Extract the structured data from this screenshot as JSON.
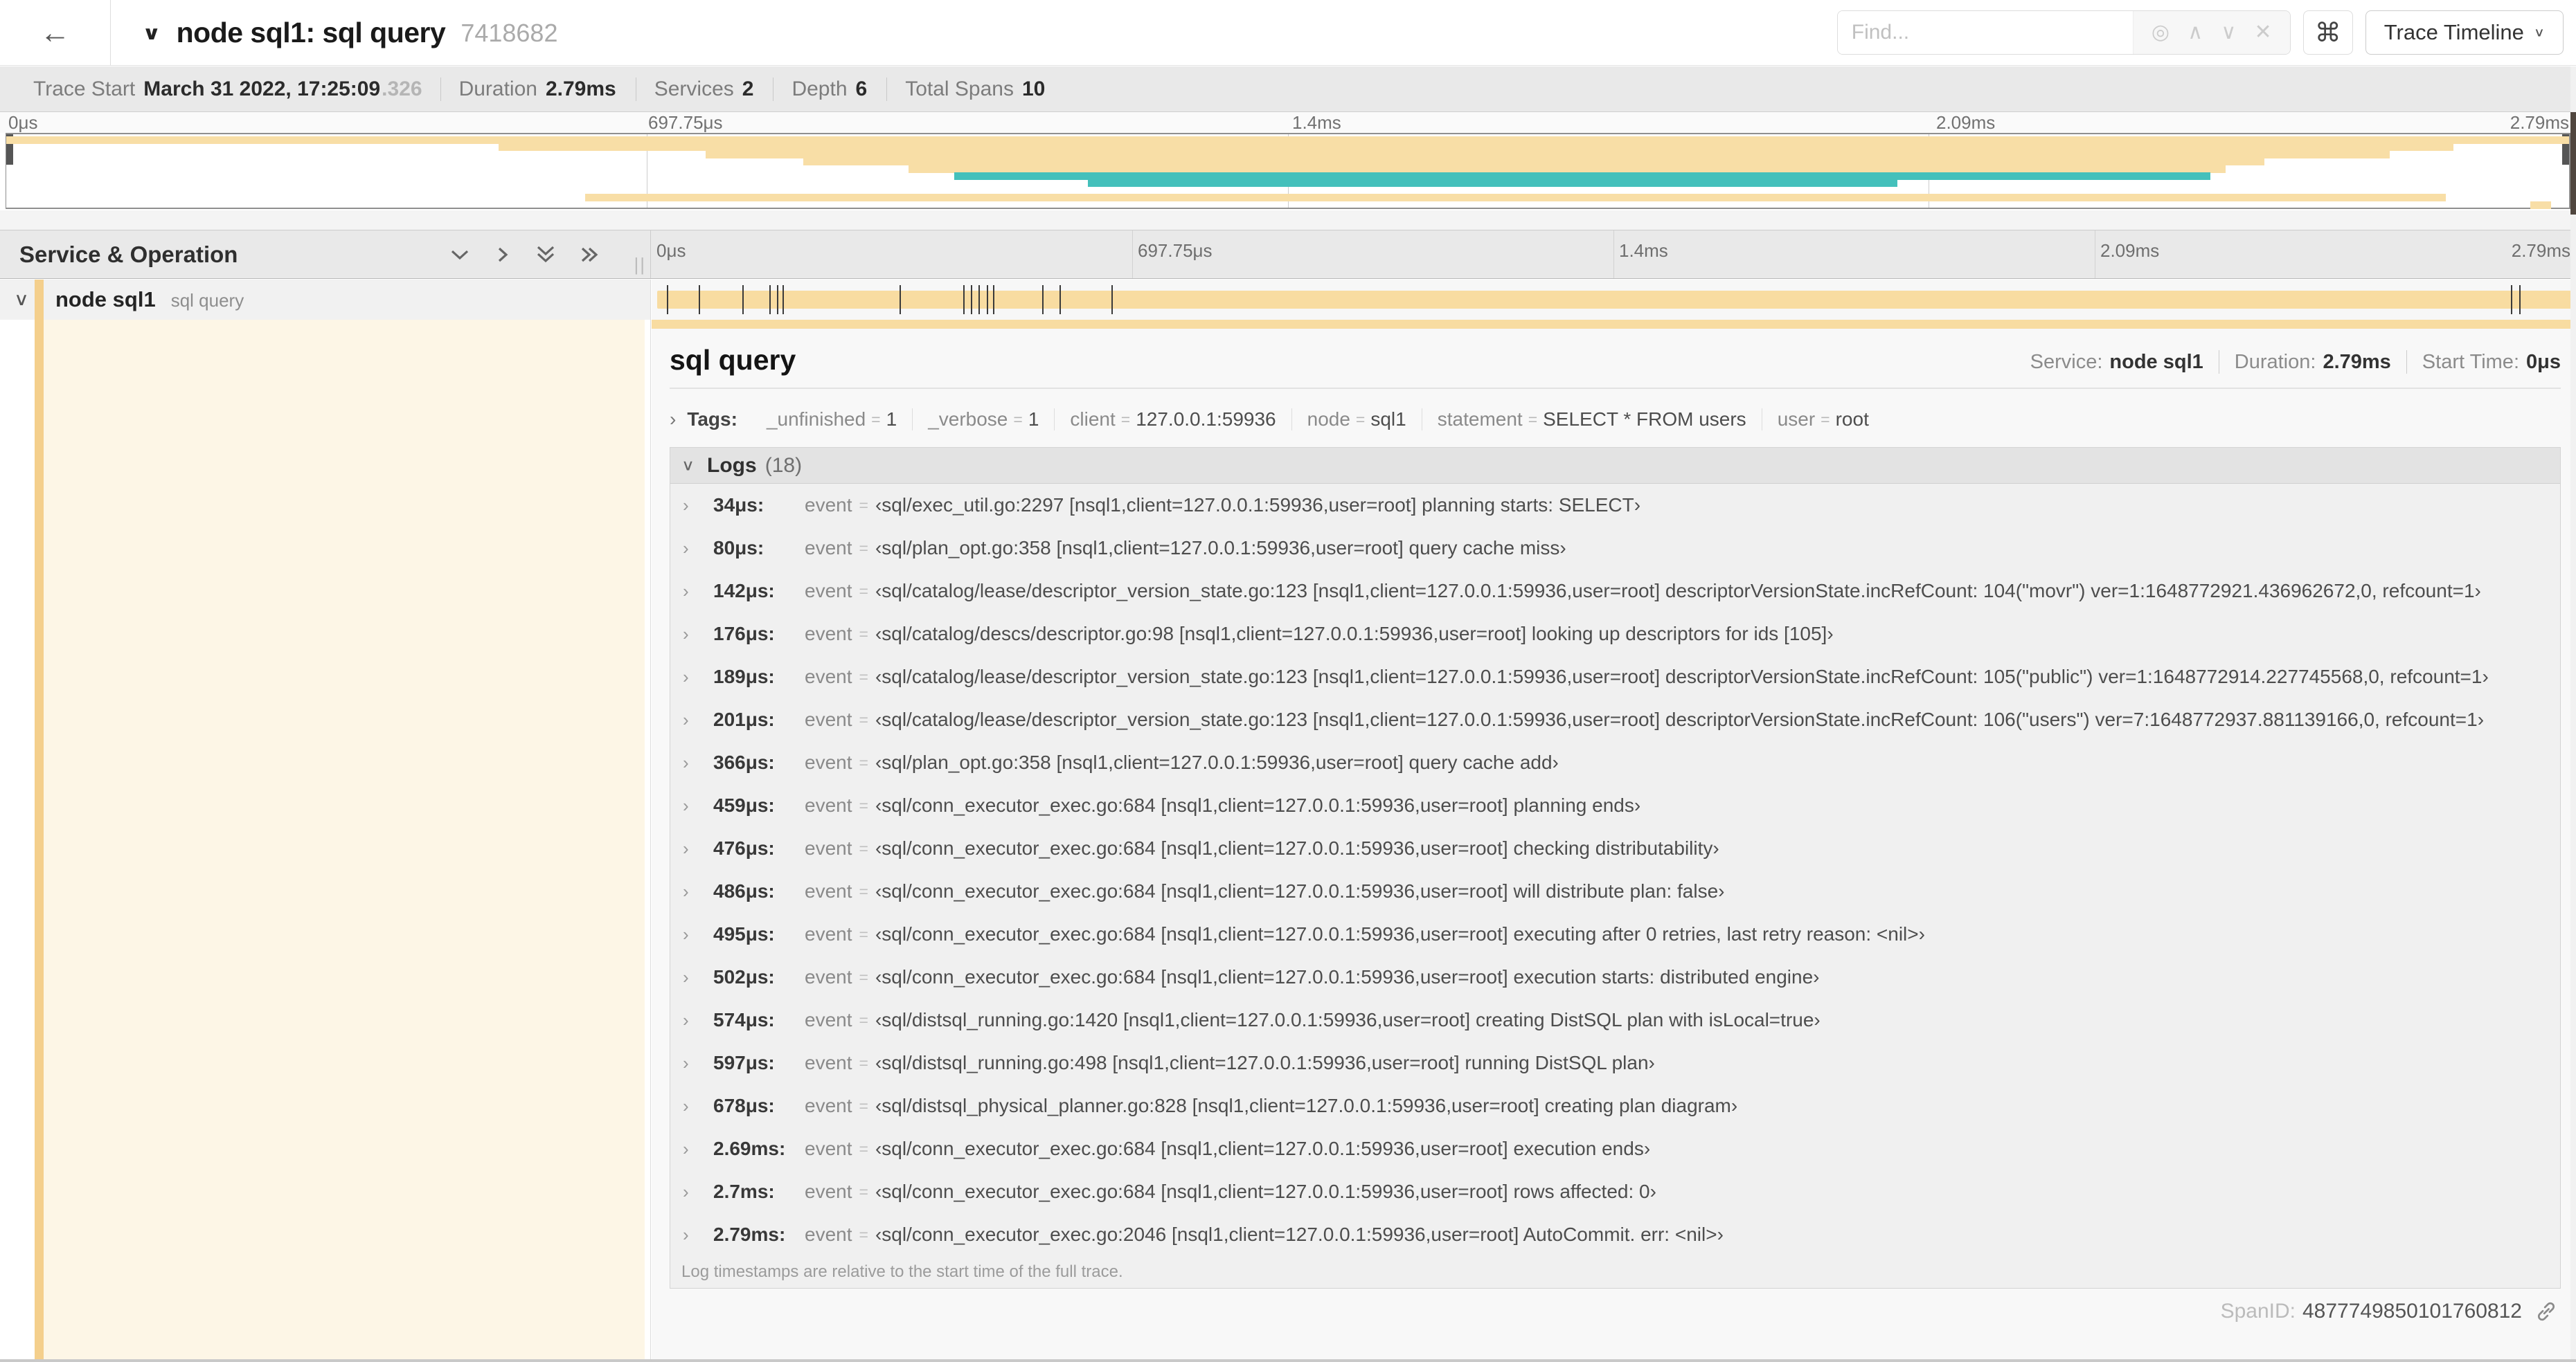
{
  "header": {
    "back_icon": "←",
    "collapse_icon": "∨",
    "title": "node sql1: sql query",
    "trace_id": "7418682",
    "find_placeholder": "Find...",
    "find_icons": {
      "locate": "◎",
      "prev": "∧",
      "next": "∨",
      "clear": "✕"
    },
    "shortcut_icon": "⌘",
    "view_selector": "Trace Timeline",
    "view_selector_chevron": "∨"
  },
  "summary": {
    "items": [
      {
        "label": "Trace Start",
        "value": "March 31 2022, 17:25:09",
        "suffix": ".326"
      },
      {
        "label": "Duration",
        "value": "2.79ms",
        "suffix": ""
      },
      {
        "label": "Services",
        "value": "2",
        "suffix": ""
      },
      {
        "label": "Depth",
        "value": "6",
        "suffix": ""
      },
      {
        "label": "Total Spans",
        "value": "10",
        "suffix": ""
      }
    ]
  },
  "minimap": {
    "ticks": [
      "0μs",
      "697.75μs",
      "1.4ms",
      "2.09ms",
      "2.79ms"
    ],
    "gridlines_pct": [
      25,
      50,
      75
    ],
    "colors": {
      "tan": "#F8DEA6",
      "teal": "#44C0BB"
    },
    "rows": [
      {
        "row": 0,
        "left": 0,
        "width": 100,
        "color": "tan"
      },
      {
        "row": 1,
        "left": 19.2,
        "width": 76.3,
        "color": "tan"
      },
      {
        "row": 2,
        "left": 27.3,
        "width": 65.7,
        "color": "tan"
      },
      {
        "row": 3,
        "left": 31.1,
        "width": 57.0,
        "color": "tan"
      },
      {
        "row": 4,
        "left": 35.2,
        "width": 51.4,
        "color": "tan"
      },
      {
        "row": 5,
        "left": 37.0,
        "width": 49.0,
        "color": "teal"
      },
      {
        "row": 6,
        "left": 42.2,
        "width": 31.6,
        "color": "teal"
      },
      {
        "row": 8,
        "left": 22.6,
        "width": 72.6,
        "color": "tan"
      },
      {
        "row": 9,
        "left": 98.5,
        "width": 0.8,
        "color": "tan"
      }
    ]
  },
  "timeline": {
    "left_header": "Service & Operation",
    "drag_handle": "||",
    "ticks": [
      "0μs",
      "697.75μs",
      "1.4ms",
      "2.09ms",
      "2.79ms"
    ],
    "gridlines_pct": [
      25,
      50,
      75
    ],
    "row": {
      "chevron": "∨",
      "service": "node sql1",
      "operation": "sql query",
      "bar_color": "#F8DCA1"
    },
    "tick_marks_pct": [
      0.8,
      2.45,
      4.7,
      6.1,
      6.5,
      6.8,
      12.9,
      16.2,
      16.6,
      17.0,
      17.4,
      17.75,
      20.3,
      21.2,
      23.9,
      96.6,
      97.05,
      99.8
    ]
  },
  "detail": {
    "title": "sql query",
    "service_label": "Service:",
    "service": "node sql1",
    "duration_label": "Duration:",
    "duration": "2.79ms",
    "start_label": "Start Time:",
    "start": "0μs",
    "tags_chevron": "›",
    "tags_label": "Tags:",
    "tags": [
      {
        "key": "_unfinished",
        "value": "1"
      },
      {
        "key": "_verbose",
        "value": "1"
      },
      {
        "key": "client",
        "value": "127.0.0.1:59936"
      },
      {
        "key": "node",
        "value": "sql1"
      },
      {
        "key": "statement",
        "value": "SELECT * FROM users"
      },
      {
        "key": "user",
        "value": "root"
      }
    ],
    "logs_chevron": "∨",
    "logs_label": "Logs",
    "logs_count": "(18)",
    "log_row_chevron": "›",
    "logs": [
      {
        "time": "34μs:",
        "key": "event",
        "value": "‹sql/exec_util.go:2297 [nsql1,client=127.0.0.1:59936,user=root] planning starts: SELECT›"
      },
      {
        "time": "80μs:",
        "key": "event",
        "value": "‹sql/plan_opt.go:358 [nsql1,client=127.0.0.1:59936,user=root] query cache miss›"
      },
      {
        "time": "142μs:",
        "key": "event",
        "value": "‹sql/catalog/lease/descriptor_version_state.go:123 [nsql1,client=127.0.0.1:59936,user=root] descriptorVersionState.incRefCount: 104(\"movr\") ver=1:1648772921.436962672,0, refcount=1›"
      },
      {
        "time": "176μs:",
        "key": "event",
        "value": "‹sql/catalog/descs/descriptor.go:98 [nsql1,client=127.0.0.1:59936,user=root] looking up descriptors for ids [105]›"
      },
      {
        "time": "189μs:",
        "key": "event",
        "value": "‹sql/catalog/lease/descriptor_version_state.go:123 [nsql1,client=127.0.0.1:59936,user=root] descriptorVersionState.incRefCount: 105(\"public\") ver=1:1648772914.227745568,0, refcount=1›"
      },
      {
        "time": "201μs:",
        "key": "event",
        "value": "‹sql/catalog/lease/descriptor_version_state.go:123 [nsql1,client=127.0.0.1:59936,user=root] descriptorVersionState.incRefCount: 106(\"users\") ver=7:1648772937.881139166,0, refcount=1›"
      },
      {
        "time": "366μs:",
        "key": "event",
        "value": "‹sql/plan_opt.go:358 [nsql1,client=127.0.0.1:59936,user=root] query cache add›"
      },
      {
        "time": "459μs:",
        "key": "event",
        "value": "‹sql/conn_executor_exec.go:684 [nsql1,client=127.0.0.1:59936,user=root] planning ends›"
      },
      {
        "time": "476μs:",
        "key": "event",
        "value": "‹sql/conn_executor_exec.go:684 [nsql1,client=127.0.0.1:59936,user=root] checking distributability›"
      },
      {
        "time": "486μs:",
        "key": "event",
        "value": "‹sql/conn_executor_exec.go:684 [nsql1,client=127.0.0.1:59936,user=root] will distribute plan: false›"
      },
      {
        "time": "495μs:",
        "key": "event",
        "value": "‹sql/conn_executor_exec.go:684 [nsql1,client=127.0.0.1:59936,user=root] executing after 0 retries, last retry reason: <nil>›"
      },
      {
        "time": "502μs:",
        "key": "event",
        "value": "‹sql/conn_executor_exec.go:684 [nsql1,client=127.0.0.1:59936,user=root] execution starts: distributed engine›"
      },
      {
        "time": "574μs:",
        "key": "event",
        "value": "‹sql/distsql_running.go:1420 [nsql1,client=127.0.0.1:59936,user=root] creating DistSQL plan with isLocal=true›"
      },
      {
        "time": "597μs:",
        "key": "event",
        "value": "‹sql/distsql_running.go:498 [nsql1,client=127.0.0.1:59936,user=root] running DistSQL plan›"
      },
      {
        "time": "678μs:",
        "key": "event",
        "value": "‹sql/distsql_physical_planner.go:828 [nsql1,client=127.0.0.1:59936,user=root] creating plan diagram›"
      },
      {
        "time": "2.69ms:",
        "key": "event",
        "value": "‹sql/conn_executor_exec.go:684 [nsql1,client=127.0.0.1:59936,user=root] execution ends›"
      },
      {
        "time": "2.7ms:",
        "key": "event",
        "value": "‹sql/conn_executor_exec.go:684 [nsql1,client=127.0.0.1:59936,user=root] rows affected: 0›"
      },
      {
        "time": "2.79ms:",
        "key": "event",
        "value": "‹sql/conn_executor_exec.go:2046 [nsql1,client=127.0.0.1:59936,user=root] AutoCommit. err: <nil>›"
      }
    ],
    "footer_note": "Log timestamps are relative to the start time of the full trace.",
    "spanid_label": "SpanID:",
    "spanid": "4877749850101760812"
  }
}
